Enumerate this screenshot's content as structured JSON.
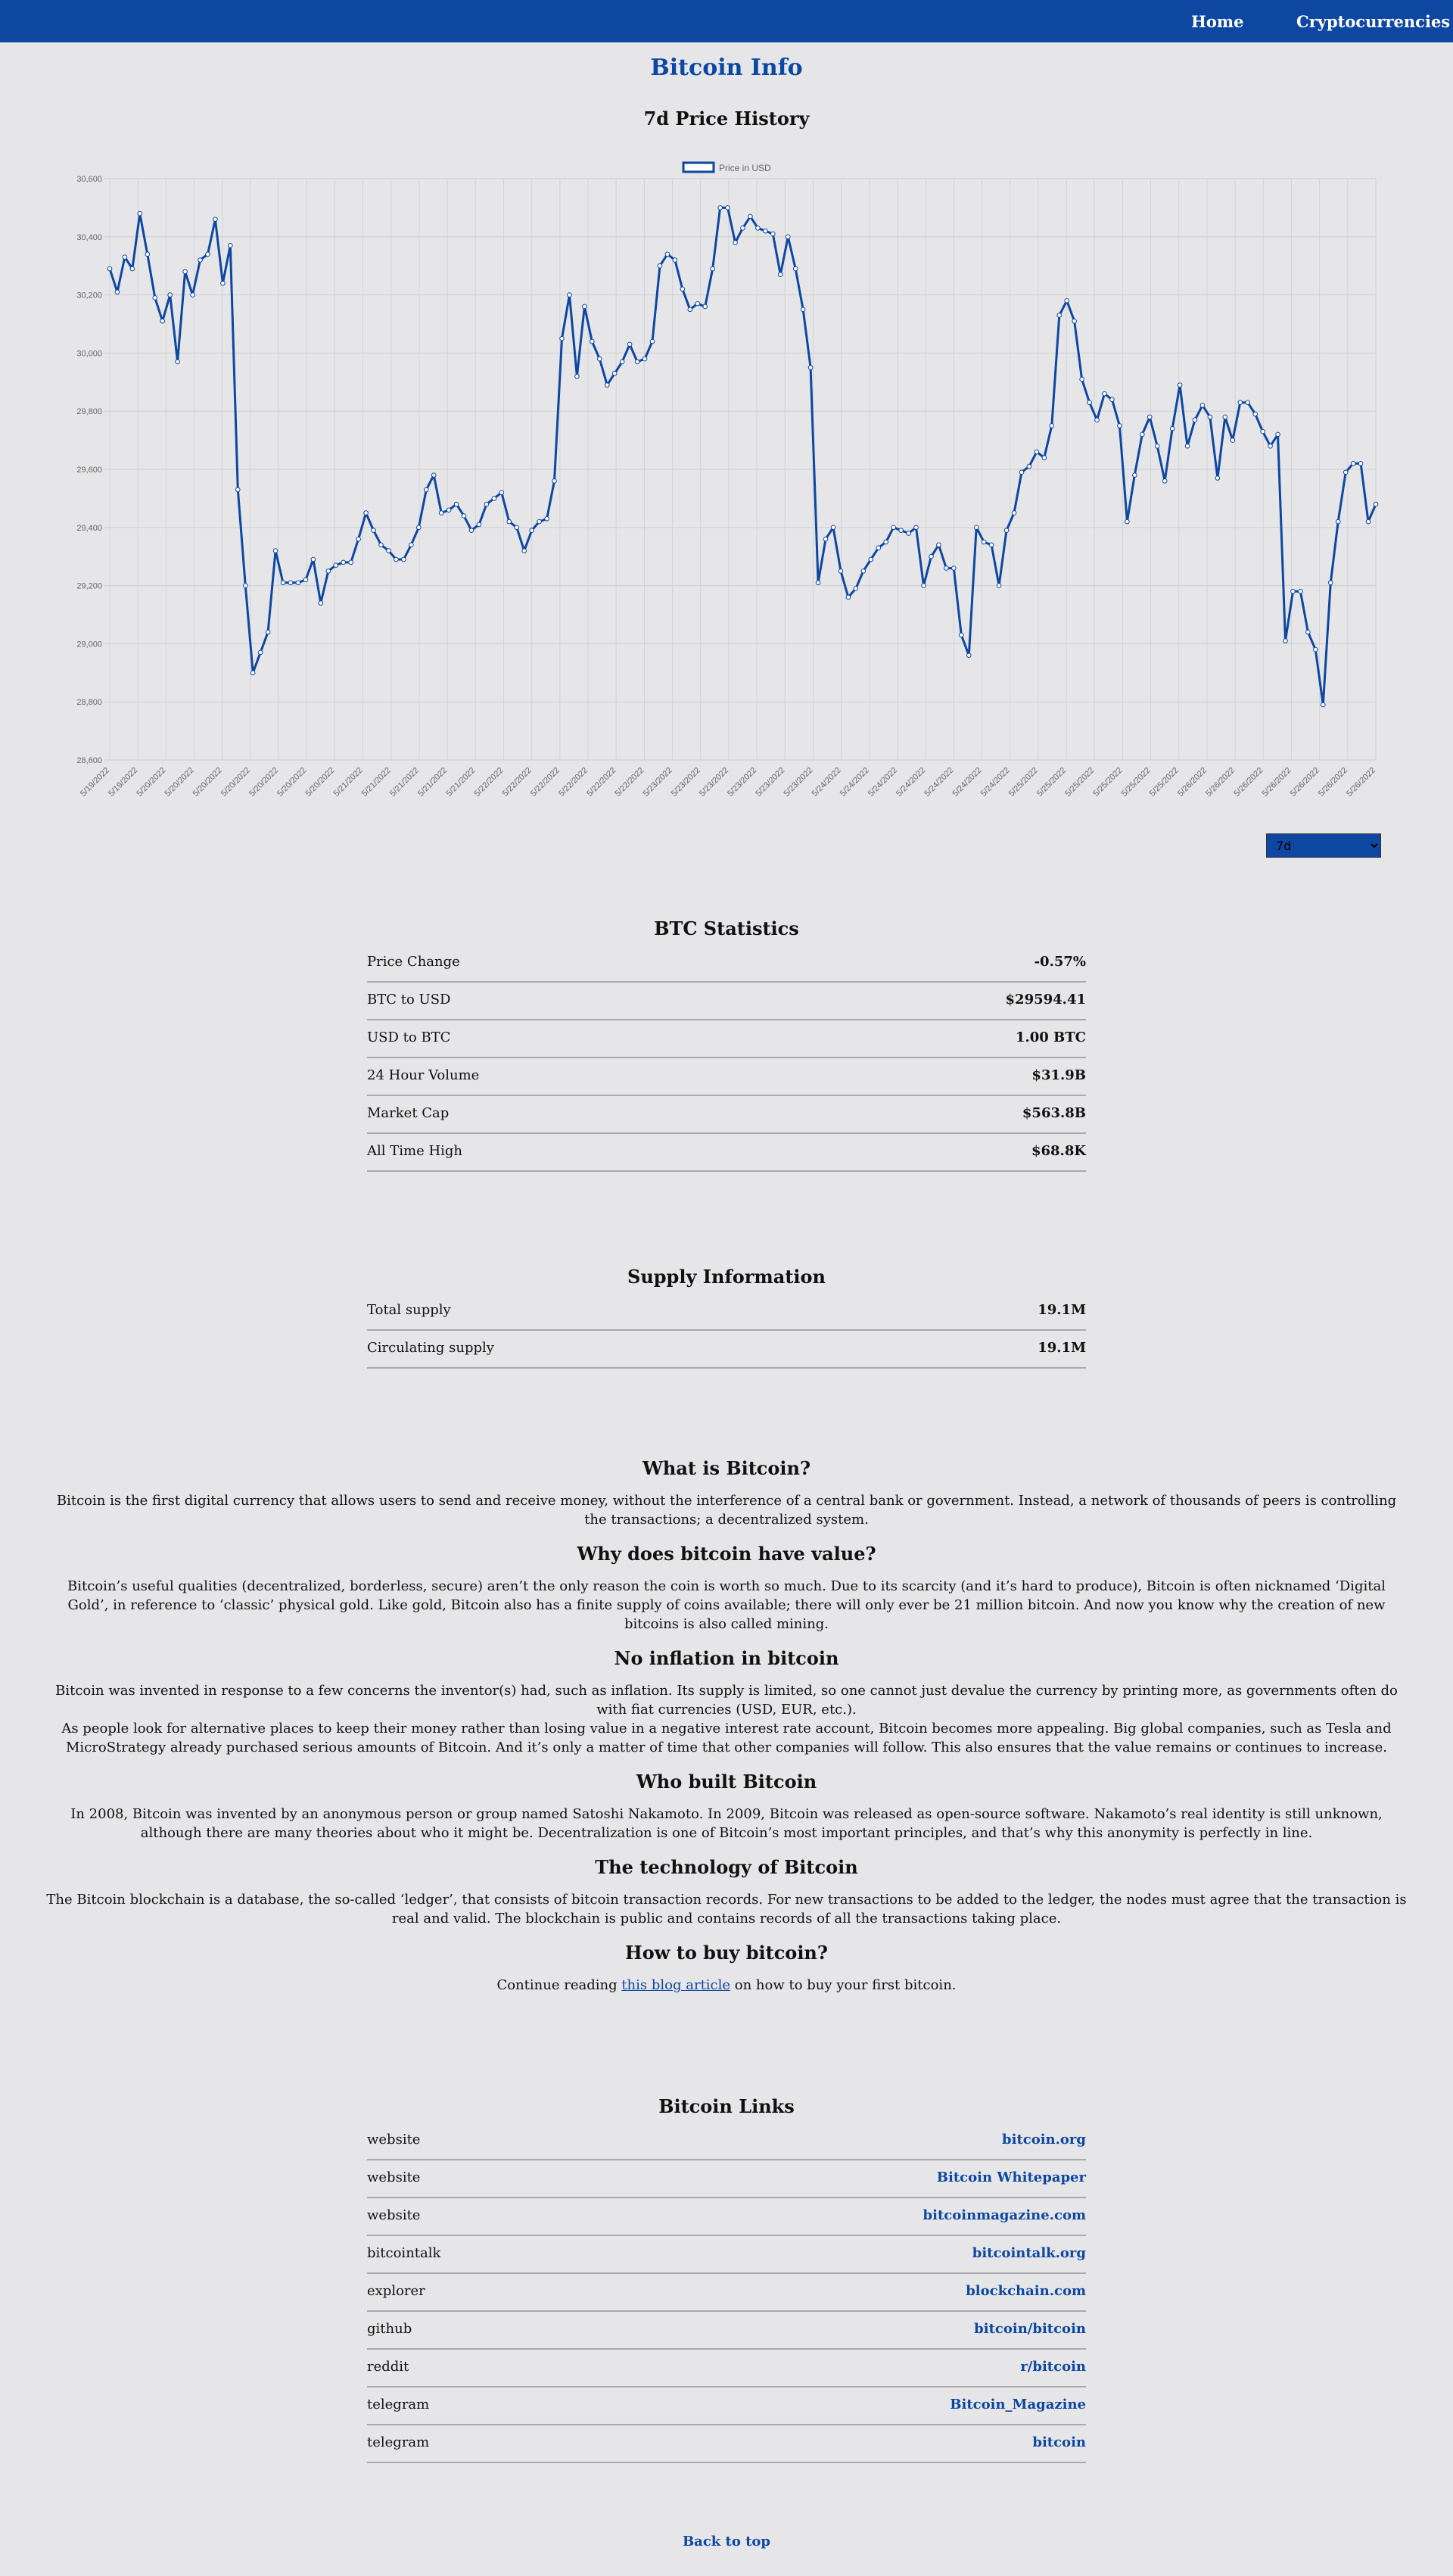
{
  "nav": {
    "home": "Home",
    "cryptocurrencies": "Cryptocurrencies"
  },
  "page_title": "Bitcoin Info",
  "chart_section_title": "7d Price History",
  "period_select": {
    "selected": "7d"
  },
  "chart_data": {
    "type": "line",
    "legend": "Price in USD",
    "legend_position": "top-center",
    "grid": true,
    "ylim": [
      28600,
      30600
    ],
    "y_ticks": [
      "30,600",
      "30,400",
      "30,200",
      "30,000",
      "29,800",
      "29,600",
      "29,400",
      "29,200",
      "29,000",
      "28,800",
      "28,600"
    ],
    "x_tick_labels": [
      "5/19/2022",
      "5/19/2022",
      "5/20/2022",
      "5/20/2022",
      "5/20/2022",
      "5/20/2022",
      "5/20/2022",
      "5/20/2022",
      "5/20/2022",
      "5/21/2022",
      "5/21/2022",
      "5/21/2022",
      "5/21/2022",
      "5/21/2022",
      "5/22/2022",
      "5/22/2022",
      "5/22/2022",
      "5/22/2022",
      "5/22/2022",
      "5/22/2022",
      "5/23/2022",
      "5/23/2022",
      "5/23/2022",
      "5/23/2022",
      "5/23/2022",
      "5/23/2022",
      "5/24/2022",
      "5/24/2022",
      "5/24/2022",
      "5/24/2022",
      "5/24/2022",
      "5/24/2022",
      "5/24/2022",
      "5/25/2022",
      "5/25/2022",
      "5/25/2022",
      "5/25/2022",
      "5/25/2022",
      "5/25/2022",
      "5/26/2022",
      "5/26/2022",
      "5/26/2022",
      "5/26/2022",
      "5/26/2022",
      "5/26/2022",
      "5/26/2022"
    ],
    "series": [
      {
        "name": "Price in USD",
        "color": "#0d47a1",
        "values": [
          30290,
          30210,
          30330,
          30290,
          30480,
          30340,
          30190,
          30110,
          30200,
          29970,
          30280,
          30200,
          30320,
          30340,
          30460,
          30240,
          30370,
          29530,
          29200,
          28900,
          28970,
          29040,
          29320,
          29210,
          29210,
          29210,
          29220,
          29290,
          29140,
          29250,
          29270,
          29280,
          29280,
          29360,
          29450,
          29390,
          29340,
          29320,
          29290,
          29290,
          29340,
          29400,
          29530,
          29580,
          29450,
          29460,
          29480,
          29440,
          29390,
          29410,
          29480,
          29500,
          29520,
          29420,
          29400,
          29320,
          29390,
          29420,
          29430,
          29560,
          30050,
          30200,
          29920,
          30160,
          30040,
          29980,
          29890,
          29930,
          29970,
          30030,
          29970,
          29980,
          30040,
          30300,
          30340,
          30320,
          30220,
          30150,
          30170,
          30160,
          30290,
          30500,
          30500,
          30380,
          30430,
          30470,
          30430,
          30420,
          30410,
          30270,
          30400,
          30290,
          30150,
          29950,
          29210,
          29360,
          29400,
          29250,
          29160,
          29190,
          29250,
          29290,
          29330,
          29350,
          29400,
          29390,
          29380,
          29400,
          29200,
          29300,
          29340,
          29260,
          29260,
          29030,
          28960,
          29400,
          29350,
          29340,
          29200,
          29390,
          29450,
          29590,
          29610,
          29660,
          29640,
          29750,
          30130,
          30180,
          30110,
          29910,
          29830,
          29770,
          29860,
          29840,
          29750,
          29420,
          29580,
          29720,
          29780,
          29680,
          29560,
          29740,
          29890,
          29680,
          29770,
          29820,
          29780,
          29570,
          29780,
          29700,
          29830,
          29830,
          29790,
          29730,
          29680,
          29720,
          29010,
          29180,
          29180,
          29040,
          28980,
          28790,
          29210,
          29420,
          29590,
          29620,
          29620,
          29420,
          29480
        ]
      }
    ]
  },
  "stats": {
    "title": "BTC Statistics",
    "rows": [
      {
        "label": "Price Change",
        "value": "-0.57%"
      },
      {
        "label": "BTC to USD",
        "value": "$29594.41"
      },
      {
        "label": "USD to BTC",
        "value": "1.00 BTC"
      },
      {
        "label": "24 Hour Volume",
        "value": "$31.9B"
      },
      {
        "label": "Market Cap",
        "value": "$563.8B"
      },
      {
        "label": "All Time High",
        "value": "$68.8K"
      }
    ]
  },
  "supply": {
    "title": "Supply Information",
    "rows": [
      {
        "label": "Total supply",
        "value": "19.1M"
      },
      {
        "label": "Circulating supply",
        "value": "19.1M"
      }
    ]
  },
  "about": {
    "what_title": "What is Bitcoin?",
    "what_text": "Bitcoin is the first digital currency that allows users to send and receive money, without the interference of a central bank or government. Instead, a network of thousands of peers is controlling the transactions; a decentralized system.",
    "value_title": "Why does bitcoin have value?",
    "value_text": "Bitcoin’s useful qualities (decentralized, borderless, secure) aren’t the only reason the coin is worth so much. Due to its scarcity (and it’s hard to produce), Bitcoin is often nicknamed ‘Digital Gold’, in reference to ‘classic’ physical gold. Like gold, Bitcoin also has a finite supply of coins available; there will only ever be 21 million bitcoin. And now you know why the creation of new bitcoins is also called mining.",
    "inflation_title": "No inflation in bitcoin",
    "inflation_text1": "Bitcoin was invented in response to a few concerns the inventor(s) had, such as inflation. Its supply is limited, so one cannot just devalue the currency by printing more, as governments often do with fiat currencies (USD, EUR, etc.).",
    "inflation_text2": "As people look for alternative places to keep their money rather than losing value in a negative interest rate account, Bitcoin becomes more appealing. Big global companies, such as Tesla and MicroStrategy already purchased serious amounts of Bitcoin. And it’s only a matter of time that other companies will follow. This also ensures that the value remains or continues to increase.",
    "who_title": "Who built Bitcoin",
    "who_text": "In 2008, Bitcoin was invented by an anonymous person or group named Satoshi Nakamoto. In 2009, Bitcoin was released as open-source software. Nakamoto’s real identity is still unknown, although there are many theories about who it might be. Decentralization is one of Bitcoin’s most important principles, and that’s why this anonymity is perfectly in line.",
    "tech_title": "The technology of Bitcoin",
    "tech_text": "The Bitcoin blockchain is a database, the so-called ‘ledger’, that consists of bitcoin transaction records. For new transactions to be added to the ledger, the nodes must agree that the transaction is real and valid. The blockchain is public and contains records of all the transactions taking place.",
    "buy_title": "How to buy bitcoin?",
    "buy_prefix": "Continue reading ",
    "buy_link": "this blog article",
    "buy_suffix": " on how to buy your first bitcoin."
  },
  "links": {
    "title": "Bitcoin Links",
    "rows": [
      {
        "label": "website",
        "value": "bitcoin.org"
      },
      {
        "label": "website",
        "value": "Bitcoin Whitepaper"
      },
      {
        "label": "website",
        "value": "bitcoinmagazine.com"
      },
      {
        "label": "bitcointalk",
        "value": "bitcointalk.org"
      },
      {
        "label": "explorer",
        "value": "blockchain.com"
      },
      {
        "label": "github",
        "value": "bitcoin/bitcoin"
      },
      {
        "label": "reddit",
        "value": "r/bitcoin"
      },
      {
        "label": "telegram",
        "value": "Bitcoin_Magazine"
      },
      {
        "label": "telegram",
        "value": "bitcoin"
      }
    ]
  },
  "back_to_top": "Back to top"
}
